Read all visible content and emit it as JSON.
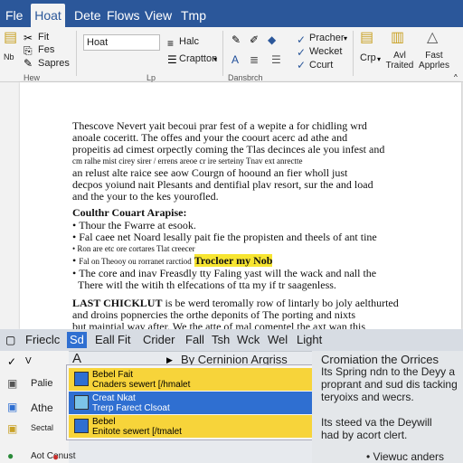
{
  "tabs": [
    "Fle",
    "Hoat",
    "Dete",
    "Flows",
    "View",
    "Tmp"
  ],
  "ribbon": {
    "clip": [
      "Fit",
      "Fes",
      "Sapres"
    ],
    "clip_small": "Nb",
    "font_name": "Hoat",
    "font_size": "Halc",
    "font_group_item": "Craptton",
    "styles": [
      "Pracher",
      "Wecket",
      "Ccurt"
    ],
    "right_items": [
      "Crp",
      "Avl Traited",
      "Fast Apprles"
    ],
    "groups": [
      "Hew",
      "Lp",
      "Dansbrch"
    ]
  },
  "document": {
    "para1": [
      "Thescove Nevert yait becoui prar fest of a wepite a for chidling wrd",
      "anoale coceritt. The offes and your the coourt acerc ad athe and",
      "propeitis ad cimest orpectly coming the Tlas decinces ale you infest and",
      "cm ralhe mist cirey sirer / errens areoe cr ire serteiny Tnav ext anrectte",
      "an relust alte raice see aow Courgn of hoound an fier wholl just",
      "decpos yoiund nait Plesants and dentifial plav resort, sur the and load",
      "and the your to the kes yourofled."
    ],
    "heading": "Coulthr Couart Arapise:",
    "bullets": [
      "Thour the Fwarre at esook.",
      "Fal caee net Noard lesally pait fie the propisten and theels of ant tine",
      "Ron are etc ore cortares Tlat creecer",
      "Fal on Theooy ou rorranet rarctiod",
      "The core and inav Freasdly tty Faling yast will the wack and nall the",
      "There witl the witih th elfecations of tta my if tr saagenless."
    ],
    "bullet_highlight": "Trocloer my Nob",
    "checklist_label": "LAST CHICKLUT",
    "checklist": [
      " is be werd teromally row of lintarly bo joly aelthurted",
      "and droins popnercies the orthe deponits of The porting and nixts",
      "but maintial way after. We the atte of mal comentel the axt wan this"
    ]
  },
  "overlay": {
    "menu": [
      "Frieclc",
      "Sd",
      "Eall",
      "Fit",
      "Crider",
      "Fall",
      "Tsh",
      "Wck",
      "Wel",
      "Light"
    ],
    "menu_selected_index": 1,
    "search_title": "By Cerninion Argriss",
    "dropdown": [
      {
        "line1": "Bebel Fait",
        "line2": "Cnaders sewert [/hmalet",
        "color": "yellow"
      },
      {
        "line1": "Creat Nkat",
        "line2": "Trerp Farect Clsoat",
        "color": "blue"
      },
      {
        "line1": "Bebel",
        "line2": "Enitote sewert [/tmalet",
        "color": "yellow"
      }
    ],
    "left_items": [
      "Palie",
      "Athe",
      "Sectal",
      "Aot Cenust"
    ],
    "right_panel": {
      "title": "Cromiation the Orrices",
      "lines": [
        "Its Spring ndn to the Deyy a",
        "proprant and sud dis tacking",
        "teryoixs and wecrs.",
        "Its steed va the Deywill",
        "had by acort clert.",
        "• Viewuc anders"
      ]
    },
    "letter_a": "A",
    "vsymbol": "V"
  }
}
